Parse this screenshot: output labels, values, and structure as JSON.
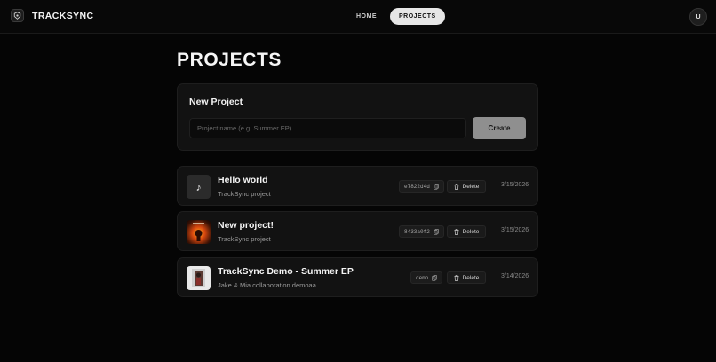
{
  "app": {
    "name": "TRACKSYNC"
  },
  "nav": {
    "tabs": [
      {
        "label": "HOME",
        "active": false
      },
      {
        "label": "PROJECTS",
        "active": true
      }
    ]
  },
  "user": {
    "avatar_initial": "U"
  },
  "page": {
    "title": "PROJECTS"
  },
  "new_project": {
    "title": "New Project",
    "placeholder": "Project name (e.g. Summer EP)",
    "value": "",
    "create_label": "Create"
  },
  "projects": [
    {
      "name": "Hello world",
      "subtitle": "TrackSync project",
      "code": "e7822d4d",
      "delete_label": "Delete",
      "date": "3/15/2026",
      "thumb": "music-note-icon"
    },
    {
      "name": "New project!",
      "subtitle": "TrackSync project",
      "code": "8433a0f2",
      "delete_label": "Delete",
      "date": "3/15/2026",
      "thumb": "album-art"
    },
    {
      "name": "TrackSync Demo - Summer EP",
      "subtitle": "Jake & Mia collaboration demoaa",
      "code": "demo",
      "delete_label": "Delete",
      "date": "3/14/2026",
      "thumb": "album-art"
    }
  ],
  "colors": {
    "background": "#050505",
    "card": "#121212",
    "create_button": "#8f8f8f",
    "active_tab": "#e6e6e6"
  }
}
